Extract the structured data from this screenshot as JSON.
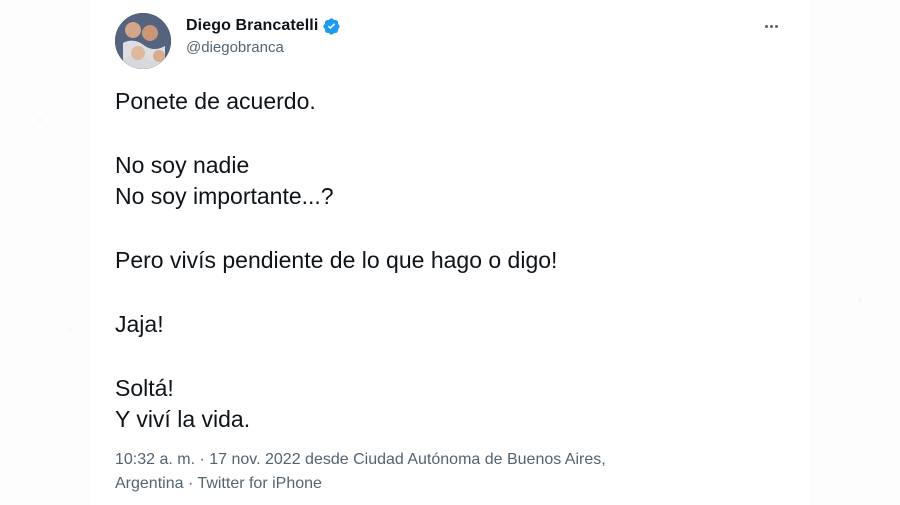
{
  "tweet": {
    "author": {
      "name": "Diego Brancatelli",
      "handle": "@diegobranca"
    },
    "text_lines": [
      "Ponete de acuerdo.",
      "",
      "No soy nadie",
      "No soy importante...?",
      "",
      "Pero vivís pendiente de lo que hago o digo!",
      "",
      "Jaja!",
      "",
      "Soltá!",
      "Y viví la vida."
    ],
    "meta": {
      "line1": "10:32 a. m. · 17 nov. 2022 desde Ciudad Autónoma de Buenos Aires,",
      "line2": "Argentina · Twitter for iPhone"
    }
  },
  "colors": {
    "verified": "#1d9bf0",
    "text": "#0f1419",
    "muted": "#536471"
  },
  "icons": {
    "verified": "verified-badge-icon",
    "more": "more-icon"
  }
}
